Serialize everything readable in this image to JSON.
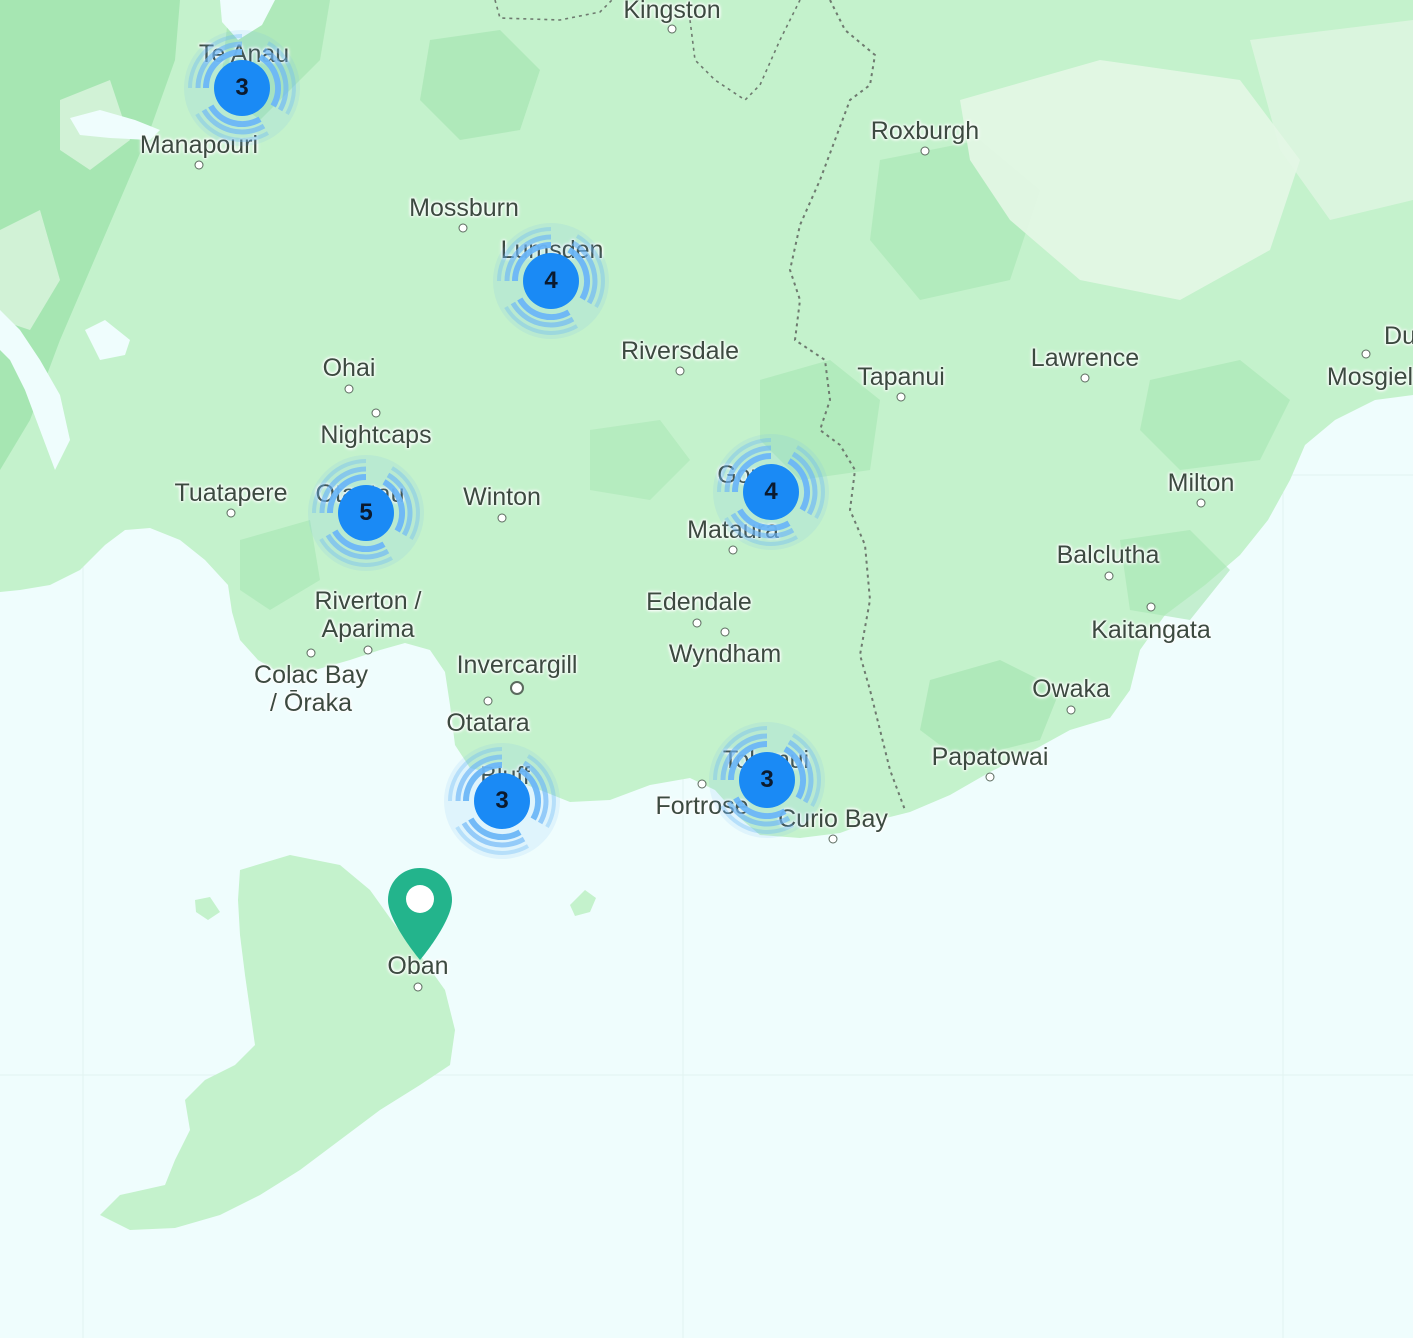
{
  "map": {
    "colors": {
      "sea": "#effdfd",
      "land": "#c4f2cc",
      "land_dark": "#a6e6b2",
      "land_pale": "#e4f7e6",
      "cluster": "#1a8af5",
      "cluster_ring": "#6bb6f7",
      "marker": "#23b48c"
    },
    "places": [
      {
        "id": "kingston",
        "name": "Kingston"
      },
      {
        "id": "te-anau",
        "name": "Te Anau"
      },
      {
        "id": "manapouri",
        "name": "Manapouri"
      },
      {
        "id": "roxburgh",
        "name": "Roxburgh"
      },
      {
        "id": "mossburn",
        "name": "Mossburn"
      },
      {
        "id": "lumsden",
        "name": "Lumsden"
      },
      {
        "id": "riversdale",
        "name": "Riversdale"
      },
      {
        "id": "ohai",
        "name": "Ohai"
      },
      {
        "id": "tapanui",
        "name": "Tapanui"
      },
      {
        "id": "lawrence",
        "name": "Lawrence"
      },
      {
        "id": "du",
        "name": "Du"
      },
      {
        "id": "mosgiel",
        "name": "Mosgiel"
      },
      {
        "id": "nightcaps",
        "name": "Nightcaps"
      },
      {
        "id": "tuatapere",
        "name": "Tuatapere"
      },
      {
        "id": "otautau",
        "name": "Otautau"
      },
      {
        "id": "winton",
        "name": "Winton"
      },
      {
        "id": "gore",
        "name": "Gore"
      },
      {
        "id": "mataura",
        "name": "Mataura"
      },
      {
        "id": "milton",
        "name": "Milton"
      },
      {
        "id": "balclutha",
        "name": "Balclutha"
      },
      {
        "id": "riverton",
        "name": "Riverton /"
      },
      {
        "id": "aparima",
        "name": "Aparima"
      },
      {
        "id": "edendale",
        "name": "Edendale"
      },
      {
        "id": "kaitangata",
        "name": "Kaitangata"
      },
      {
        "id": "wyndham",
        "name": "Wyndham"
      },
      {
        "id": "colac-bay",
        "name": "Colac Bay"
      },
      {
        "id": "oraka",
        "name": "/ Ōraka"
      },
      {
        "id": "invercargill",
        "name": "Invercargill"
      },
      {
        "id": "owaka",
        "name": "Owaka"
      },
      {
        "id": "otatara",
        "name": "Otatara"
      },
      {
        "id": "tokanui",
        "name": "Tokanui"
      },
      {
        "id": "papatowai",
        "name": "Papatowai"
      },
      {
        "id": "bluff",
        "name": "Bluff"
      },
      {
        "id": "fortrose",
        "name": "Fortrose"
      },
      {
        "id": "curio-bay",
        "name": "Curio Bay"
      },
      {
        "id": "oban",
        "name": "Oban"
      }
    ],
    "clusters": [
      {
        "id": "te-anau",
        "count": "3"
      },
      {
        "id": "lumsden",
        "count": "4"
      },
      {
        "id": "otautau",
        "count": "5"
      },
      {
        "id": "gore",
        "count": "4"
      },
      {
        "id": "bluff",
        "count": "3"
      },
      {
        "id": "tokanui",
        "count": "3"
      }
    ],
    "marker": {
      "id": "oban",
      "icon": "map-pin-icon"
    }
  }
}
